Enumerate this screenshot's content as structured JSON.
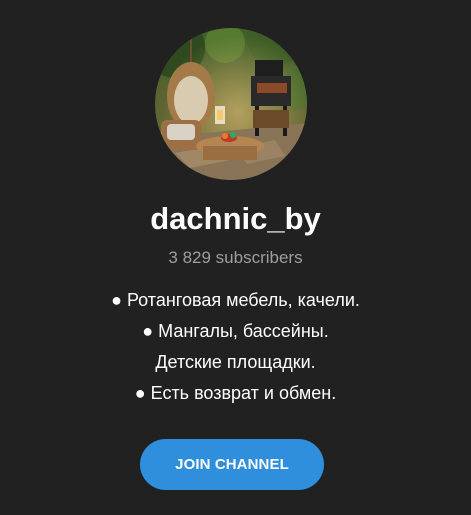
{
  "channel": {
    "name": "dachnic_by",
    "subscribers": "3 829 subscribers",
    "description": [
      "● Ротанговая мебель, качели.",
      "● Мангалы, бассейны.",
      "Детские площадки.",
      "● Есть возврат и обмен."
    ],
    "avatar_icon": "garden-furniture-photo"
  },
  "actions": {
    "join_label": "JOIN CHANNEL"
  },
  "colors": {
    "background": "#212121",
    "accent": "#2f8fdc",
    "secondary_text": "#9e9e9e"
  }
}
